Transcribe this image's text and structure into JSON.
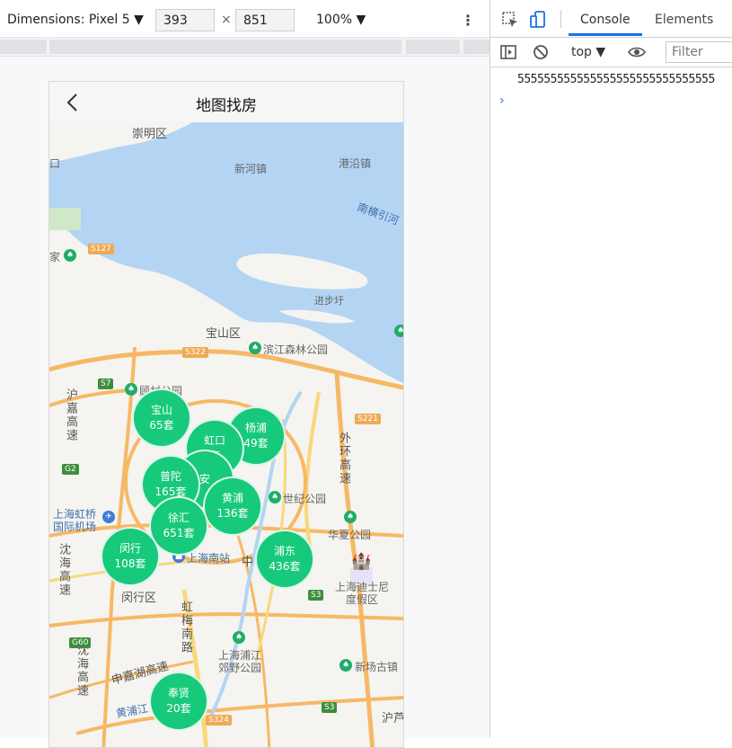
{
  "device_toolbar": {
    "dimensions_label": "Dimensions: Pixel 5 ▼",
    "width": "393",
    "times": "×",
    "height": "851",
    "zoom": "100% ▼",
    "more": "⋮"
  },
  "phone": {
    "title": "地图找房",
    "map_labels": {
      "chongming": "崇明区",
      "xinhe": "新河镇",
      "gangyan": "港沿镇",
      "nanheng": "南横引河",
      "jiabu": "进步圩",
      "baoshan_district": "宝山区",
      "binjiang_park": "滨江森林公园",
      "gucun_park": "顾村公园",
      "hujia": "沪嘉高速",
      "waihuan": "外环高速",
      "hongqiao_airport_1": "上海虹桥",
      "hongqiao_airport_2": "国际机场",
      "shenhai": "沈海高速",
      "minhang_district": "闵行区",
      "shanghai_south": "上海南站",
      "zhong": "中",
      "shiji_park": "世纪公园",
      "huaxia_park": "华夏公园",
      "disney_1": "上海迪士尼",
      "disney_2": "度假区",
      "hongmei": "虹梅南路",
      "shenjiahu": "申嘉湖高速",
      "shenhai2": "沈海高速",
      "pujiang_park_1": "上海浦江",
      "pujiang_park_2": "郊野公园",
      "xinchang": "新场古镇",
      "huangpujiang": "黄浦江",
      "hulu": "沪芦",
      "jia": "家",
      "kou": "口"
    },
    "shields": {
      "s127": "S127",
      "s322": "S322",
      "s7": "S7",
      "g2": "G2",
      "s221": "S221",
      "s3a": "S3",
      "g60": "G60",
      "s3b": "S3",
      "s324": "S324"
    },
    "clusters": [
      {
        "name": "宝山",
        "count": "65套"
      },
      {
        "name": "杨浦",
        "count": "49套"
      },
      {
        "name": "虹口",
        "count": "套"
      },
      {
        "name": "安",
        "count": ""
      },
      {
        "name": "普陀",
        "count": "165套"
      },
      {
        "name": "黄浦",
        "count": "136套"
      },
      {
        "name": "徐汇",
        "count": "651套"
      },
      {
        "name": "闵行",
        "count": "108套"
      },
      {
        "name": "浦东",
        "count": "436套"
      },
      {
        "name": "奉贤",
        "count": "20套"
      }
    ]
  },
  "devtools": {
    "tabs": [
      "Console",
      "Elements"
    ],
    "context": "top ▼",
    "filter_placeholder": "Filter",
    "console_output": "555555555555555555555555555555",
    "prompt": "›"
  }
}
